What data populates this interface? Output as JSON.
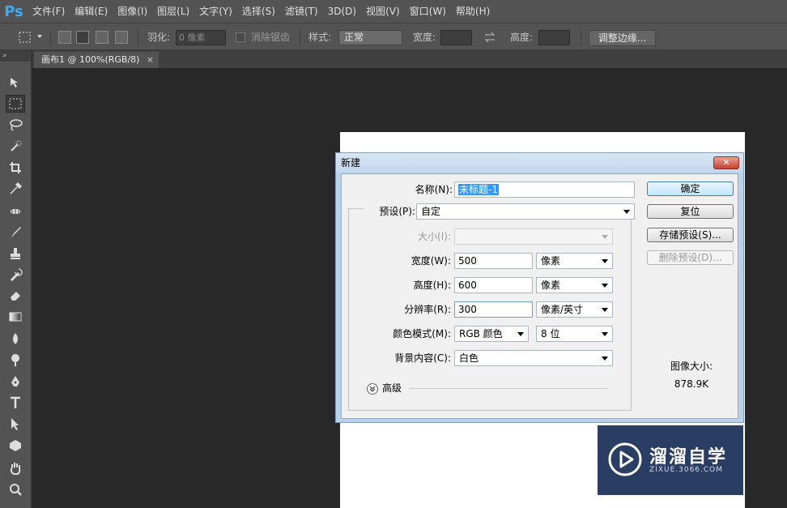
{
  "app": {
    "logo": "Ps",
    "menu": [
      "文件(F)",
      "编辑(E)",
      "图像(I)",
      "图层(L)",
      "文字(Y)",
      "选择(S)",
      "滤镜(T)",
      "3D(D)",
      "视图(V)",
      "窗口(W)",
      "帮助(H)"
    ]
  },
  "options": {
    "feather_label": "羽化:",
    "feather_placeholder": "0 像素",
    "antialias_label": "消除锯齿",
    "style_label": "样式:",
    "style_value": "正常",
    "width_label": "宽度:",
    "height_label": "高度:",
    "refine_edge_button": "调整边缘..."
  },
  "toolbar": {
    "collapse_label": "»",
    "tools": [
      "move-tool",
      "marquee-tool",
      "lasso-tool",
      "quick-select-tool",
      "crop-tool",
      "eyedropper-tool",
      "healing-brush-tool",
      "brush-tool",
      "clone-stamp-tool",
      "history-brush-tool",
      "eraser-tool",
      "gradient-tool",
      "blur-tool",
      "dodge-tool",
      "pen-tool",
      "type-tool",
      "path-select-tool",
      "shape-tool",
      "hand-tool",
      "zoom-tool"
    ]
  },
  "document": {
    "tab_title": "画布1 @ 100%(RGB/8)",
    "close_glyph": "×"
  },
  "dialog": {
    "title": "新建",
    "close_glyph": "✕",
    "name_label": "名称(N):",
    "name_value": "未标题-1",
    "preset_label": "预设(P):",
    "preset_value": "自定",
    "size_label": "大小(I):",
    "size_value": "",
    "width_label": "宽度(W):",
    "width_value": "500",
    "width_unit": "像素",
    "height_label": "高度(H):",
    "height_value": "600",
    "height_unit": "像素",
    "resolution_label": "分辨率(R):",
    "resolution_value": "300",
    "resolution_unit": "像素/英寸",
    "color_mode_label": "颜色模式(M):",
    "color_mode_value": "RGB 颜色",
    "bit_depth_value": "8 位",
    "background_label": "背景内容(C):",
    "background_value": "白色",
    "advanced_label": "高级",
    "ok_button": "确定",
    "reset_button": "复位",
    "save_preset_button": "存储预设(S)...",
    "delete_preset_button": "删除预设(D)...",
    "image_size_label": "图像大小:",
    "image_size_value": "878.9K"
  },
  "watermark": {
    "title": "溜溜自学",
    "url": "ZIXUE.3066.COM"
  },
  "colors": {
    "accent": "#3fa9f5",
    "workspace": "#282828",
    "panel": "#535353",
    "dialog_frame": "#b9d1ea",
    "watermark_bg": "#2a3d63"
  }
}
